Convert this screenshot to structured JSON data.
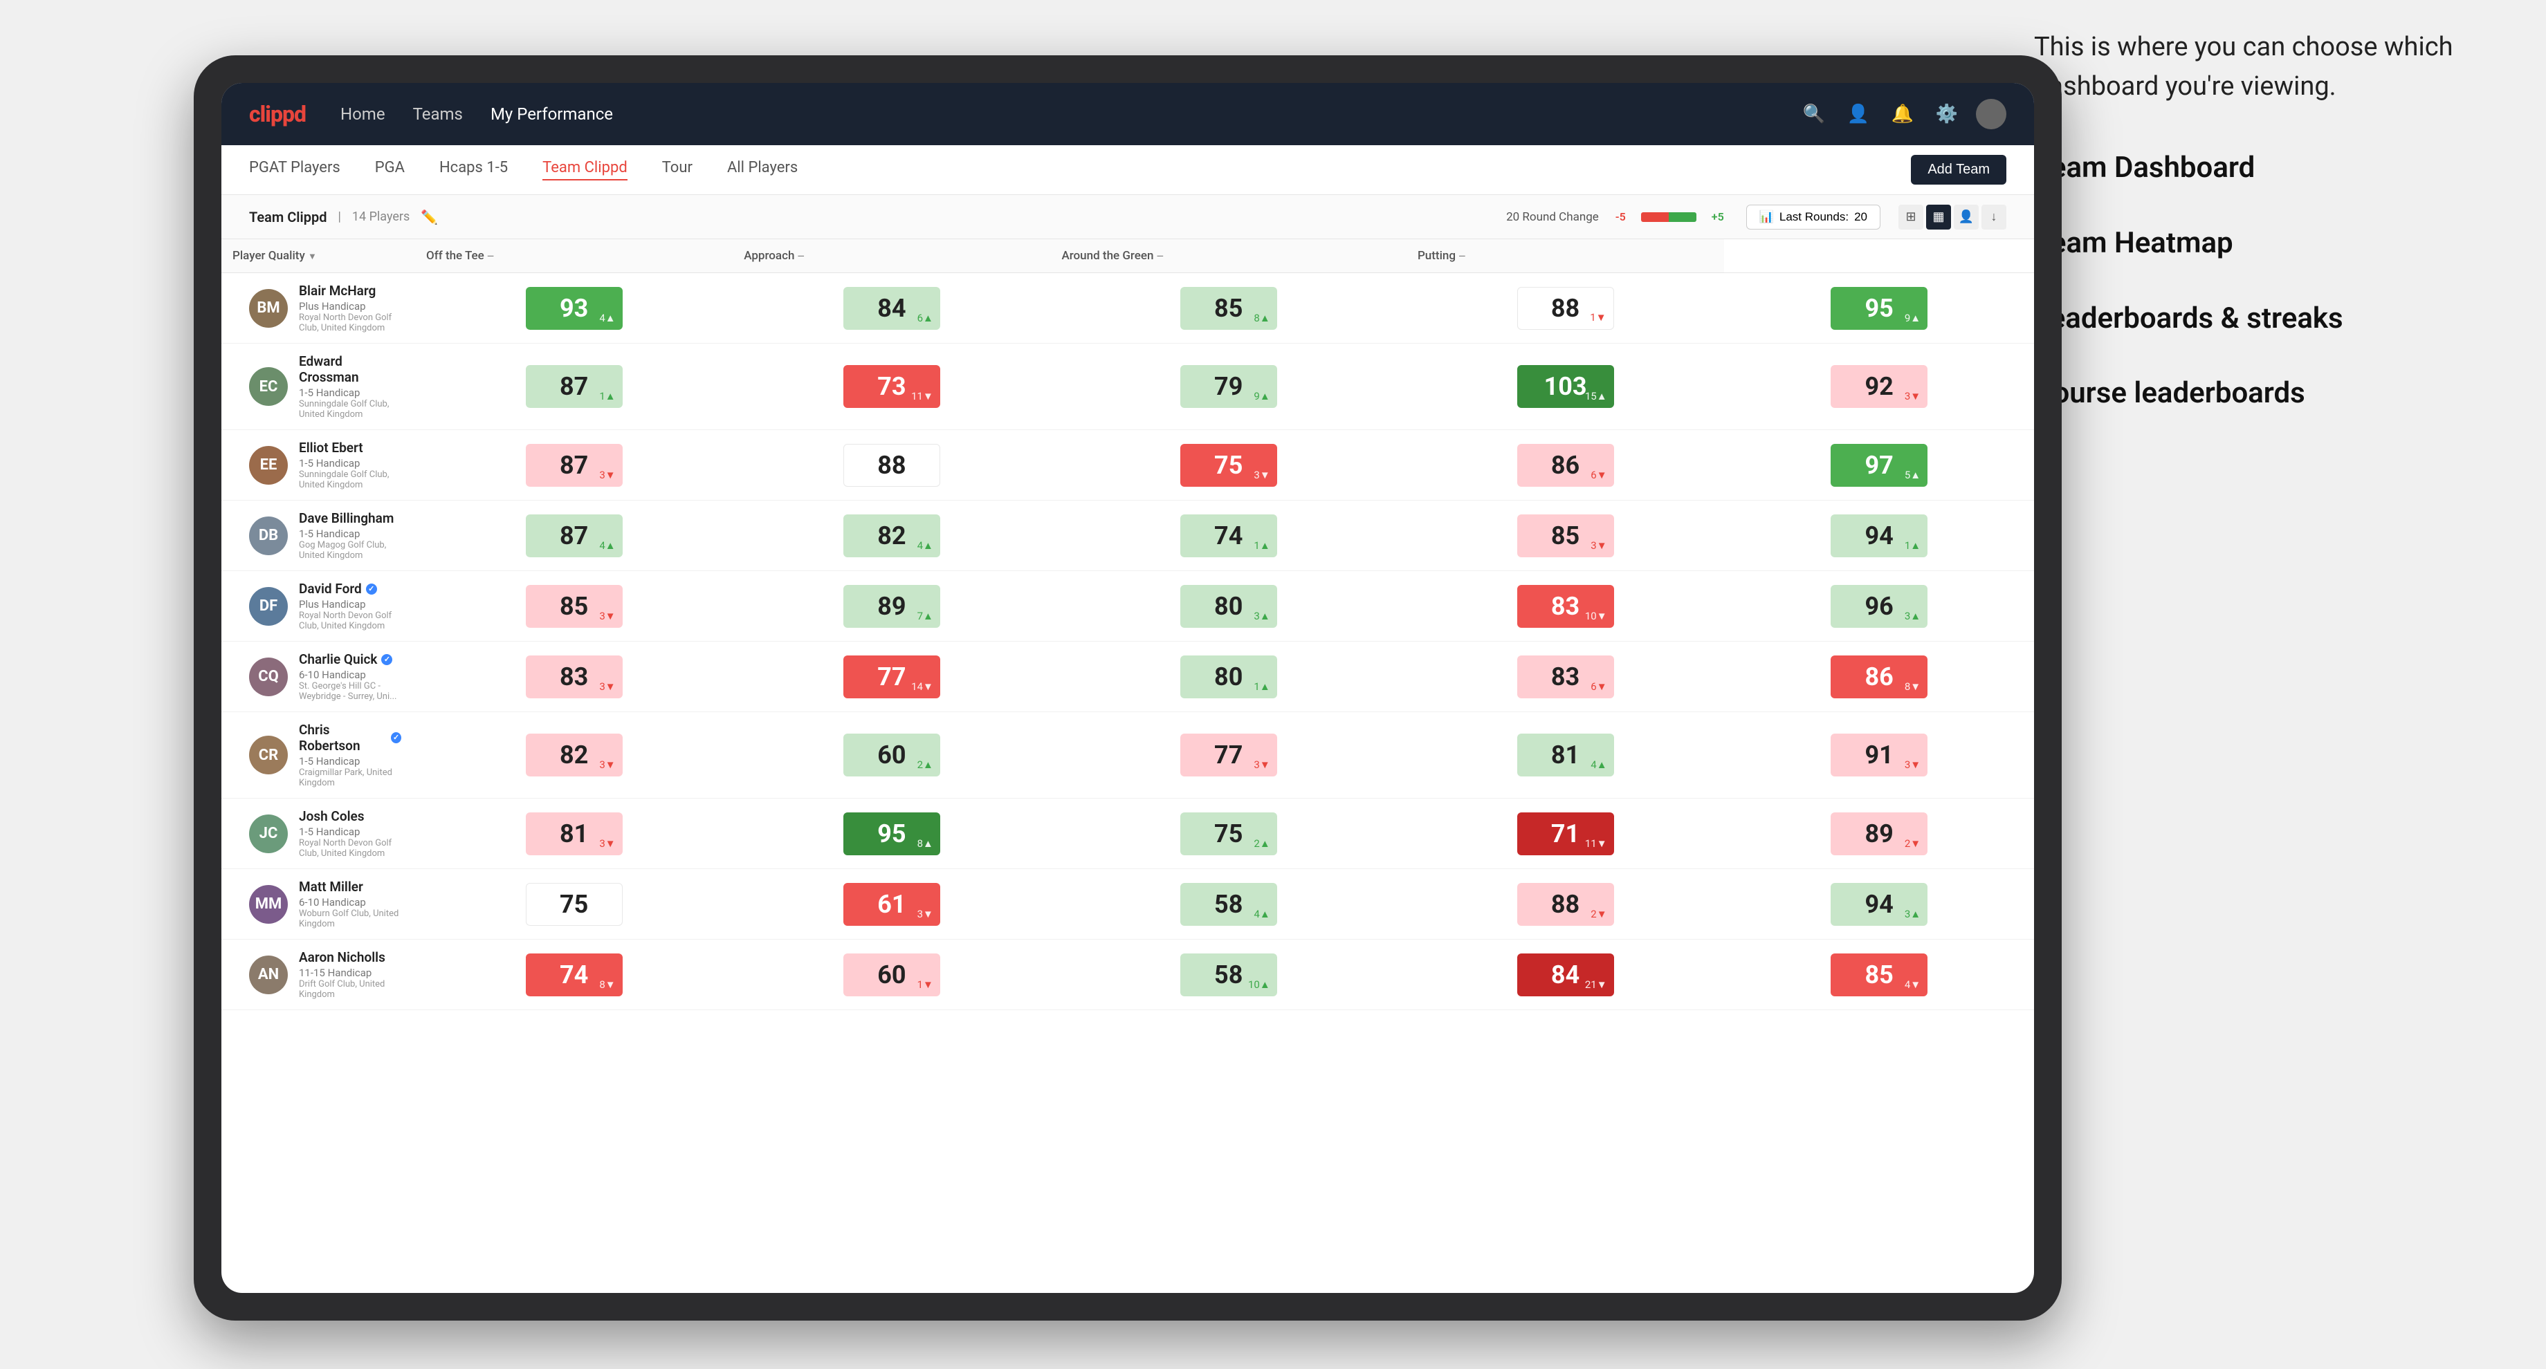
{
  "annotation": {
    "intro": "This is where you can choose which dashboard you're viewing.",
    "items": [
      "Team Dashboard",
      "Team Heatmap",
      "Leaderboards & streaks",
      "Course leaderboards"
    ]
  },
  "navbar": {
    "logo": "clippd",
    "links": [
      {
        "label": "Home",
        "active": false
      },
      {
        "label": "Teams",
        "active": false
      },
      {
        "label": "My Performance",
        "active": true
      }
    ]
  },
  "subnav": {
    "links": [
      {
        "label": "PGAT Players",
        "active": false
      },
      {
        "label": "PGA",
        "active": false
      },
      {
        "label": "Hcaps 1-5",
        "active": false
      },
      {
        "label": "Team Clippd",
        "active": true
      },
      {
        "label": "Tour",
        "active": false
      },
      {
        "label": "All Players",
        "active": false
      }
    ],
    "add_team_label": "Add Team"
  },
  "team_header": {
    "name": "Team Clippd",
    "count": "14 Players",
    "round_change_label": "20 Round Change",
    "change_neg": "-5",
    "change_pos": "+5",
    "last_rounds_label": "Last Rounds:",
    "last_rounds_value": "20"
  },
  "columns": {
    "player": "Player Quality",
    "off_tee": "Off the Tee",
    "approach": "Approach",
    "around_green": "Around the Green",
    "putting": "Putting"
  },
  "players": [
    {
      "name": "Blair McHarg",
      "handicap": "Plus Handicap",
      "club": "Royal North Devon Golf Club, United Kingdom",
      "avatar_color": "#8B7355",
      "initials": "BM",
      "scores": {
        "player_quality": {
          "value": 93,
          "change": "+4",
          "dir": "up",
          "color": "green"
        },
        "off_tee": {
          "value": 84,
          "change": "+6",
          "dir": "up",
          "color": "light-green"
        },
        "approach": {
          "value": 85,
          "change": "+8",
          "dir": "up",
          "color": "light-green"
        },
        "around_green": {
          "value": 88,
          "change": "-1",
          "dir": "down",
          "color": "white"
        },
        "putting": {
          "value": 95,
          "change": "+9",
          "dir": "up",
          "color": "green"
        }
      }
    },
    {
      "name": "Edward Crossman",
      "handicap": "1-5 Handicap",
      "club": "Sunningdale Golf Club, United Kingdom",
      "avatar_color": "#6B8E6B",
      "initials": "EC",
      "scores": {
        "player_quality": {
          "value": 87,
          "change": "+1",
          "dir": "up",
          "color": "light-green"
        },
        "off_tee": {
          "value": 73,
          "change": "-11",
          "dir": "down",
          "color": "red"
        },
        "approach": {
          "value": 79,
          "change": "+9",
          "dir": "up",
          "color": "light-green"
        },
        "around_green": {
          "value": 103,
          "change": "+15",
          "dir": "up",
          "color": "dark-green"
        },
        "putting": {
          "value": 92,
          "change": "-3",
          "dir": "down",
          "color": "light-red"
        }
      }
    },
    {
      "name": "Elliot Ebert",
      "handicap": "1-5 Handicap",
      "club": "Sunningdale Golf Club, United Kingdom",
      "avatar_color": "#9B6B4B",
      "initials": "EE",
      "scores": {
        "player_quality": {
          "value": 87,
          "change": "-3",
          "dir": "down",
          "color": "light-red"
        },
        "off_tee": {
          "value": 88,
          "change": "",
          "dir": "",
          "color": "white"
        },
        "approach": {
          "value": 75,
          "change": "-3",
          "dir": "down",
          "color": "red"
        },
        "around_green": {
          "value": 86,
          "change": "-6",
          "dir": "down",
          "color": "light-red"
        },
        "putting": {
          "value": 97,
          "change": "+5",
          "dir": "up",
          "color": "green"
        }
      }
    },
    {
      "name": "Dave Billingham",
      "handicap": "1-5 Handicap",
      "club": "Gog Magog Golf Club, United Kingdom",
      "avatar_color": "#7B8B9B",
      "initials": "DB",
      "scores": {
        "player_quality": {
          "value": 87,
          "change": "+4",
          "dir": "up",
          "color": "light-green"
        },
        "off_tee": {
          "value": 82,
          "change": "+4",
          "dir": "up",
          "color": "light-green"
        },
        "approach": {
          "value": 74,
          "change": "+1",
          "dir": "up",
          "color": "light-green"
        },
        "around_green": {
          "value": 85,
          "change": "-3",
          "dir": "down",
          "color": "light-red"
        },
        "putting": {
          "value": 94,
          "change": "+1",
          "dir": "up",
          "color": "light-green"
        }
      }
    },
    {
      "name": "David Ford",
      "handicap": "Plus Handicap",
      "club": "Royal North Devon Golf Club, United Kingdom",
      "avatar_color": "#5B7B9B",
      "initials": "DF",
      "verified": true,
      "scores": {
        "player_quality": {
          "value": 85,
          "change": "-3",
          "dir": "down",
          "color": "light-red"
        },
        "off_tee": {
          "value": 89,
          "change": "+7",
          "dir": "up",
          "color": "light-green"
        },
        "approach": {
          "value": 80,
          "change": "+3",
          "dir": "up",
          "color": "light-green"
        },
        "around_green": {
          "value": 83,
          "change": "-10",
          "dir": "down",
          "color": "red"
        },
        "putting": {
          "value": 96,
          "change": "+3",
          "dir": "up",
          "color": "light-green"
        }
      }
    },
    {
      "name": "Charlie Quick",
      "handicap": "6-10 Handicap",
      "club": "St. George's Hill GC - Weybridge - Surrey, Uni...",
      "avatar_color": "#8B6B7B",
      "initials": "CQ",
      "verified": true,
      "scores": {
        "player_quality": {
          "value": 83,
          "change": "-3",
          "dir": "down",
          "color": "light-red"
        },
        "off_tee": {
          "value": 77,
          "change": "-14",
          "dir": "down",
          "color": "red"
        },
        "approach": {
          "value": 80,
          "change": "+1",
          "dir": "up",
          "color": "light-green"
        },
        "around_green": {
          "value": 83,
          "change": "-6",
          "dir": "down",
          "color": "light-red"
        },
        "putting": {
          "value": 86,
          "change": "-8",
          "dir": "down",
          "color": "red"
        }
      }
    },
    {
      "name": "Chris Robertson",
      "handicap": "1-5 Handicap",
      "club": "Craigmillar Park, United Kingdom",
      "avatar_color": "#9B7B5B",
      "initials": "CR",
      "verified": true,
      "scores": {
        "player_quality": {
          "value": 82,
          "change": "-3",
          "dir": "down",
          "color": "light-red"
        },
        "off_tee": {
          "value": 60,
          "change": "+2",
          "dir": "up",
          "color": "light-green"
        },
        "approach": {
          "value": 77,
          "change": "-3",
          "dir": "down",
          "color": "light-red"
        },
        "around_green": {
          "value": 81,
          "change": "+4",
          "dir": "up",
          "color": "light-green"
        },
        "putting": {
          "value": 91,
          "change": "-3",
          "dir": "down",
          "color": "light-red"
        }
      }
    },
    {
      "name": "Josh Coles",
      "handicap": "1-5 Handicap",
      "club": "Royal North Devon Golf Club, United Kingdom",
      "avatar_color": "#6B9B7B",
      "initials": "JC",
      "scores": {
        "player_quality": {
          "value": 81,
          "change": "-3",
          "dir": "down",
          "color": "light-red"
        },
        "off_tee": {
          "value": 95,
          "change": "+8",
          "dir": "up",
          "color": "dark-green"
        },
        "approach": {
          "value": 75,
          "change": "+2",
          "dir": "up",
          "color": "light-green"
        },
        "around_green": {
          "value": 71,
          "change": "-11",
          "dir": "down",
          "color": "dark-red"
        },
        "putting": {
          "value": 89,
          "change": "-2",
          "dir": "down",
          "color": "light-red"
        }
      }
    },
    {
      "name": "Matt Miller",
      "handicap": "6-10 Handicap",
      "club": "Woburn Golf Club, United Kingdom",
      "avatar_color": "#7B5B8B",
      "initials": "MM",
      "scores": {
        "player_quality": {
          "value": 75,
          "change": "",
          "dir": "",
          "color": "white"
        },
        "off_tee": {
          "value": 61,
          "change": "-3",
          "dir": "down",
          "color": "red"
        },
        "approach": {
          "value": 58,
          "change": "+4",
          "dir": "up",
          "color": "light-green"
        },
        "around_green": {
          "value": 88,
          "change": "-2",
          "dir": "down",
          "color": "light-red"
        },
        "putting": {
          "value": 94,
          "change": "+3",
          "dir": "up",
          "color": "light-green"
        }
      }
    },
    {
      "name": "Aaron Nicholls",
      "handicap": "11-15 Handicap",
      "club": "Drift Golf Club, United Kingdom",
      "avatar_color": "#8B7B6B",
      "initials": "AN",
      "scores": {
        "player_quality": {
          "value": 74,
          "change": "-8",
          "dir": "down",
          "color": "red"
        },
        "off_tee": {
          "value": 60,
          "change": "-1",
          "dir": "down",
          "color": "light-red"
        },
        "approach": {
          "value": 58,
          "change": "+10",
          "dir": "up",
          "color": "light-green"
        },
        "around_green": {
          "value": 84,
          "change": "-21",
          "dir": "down",
          "color": "dark-red"
        },
        "putting": {
          "value": 85,
          "change": "-4",
          "dir": "down",
          "color": "red"
        }
      }
    }
  ]
}
